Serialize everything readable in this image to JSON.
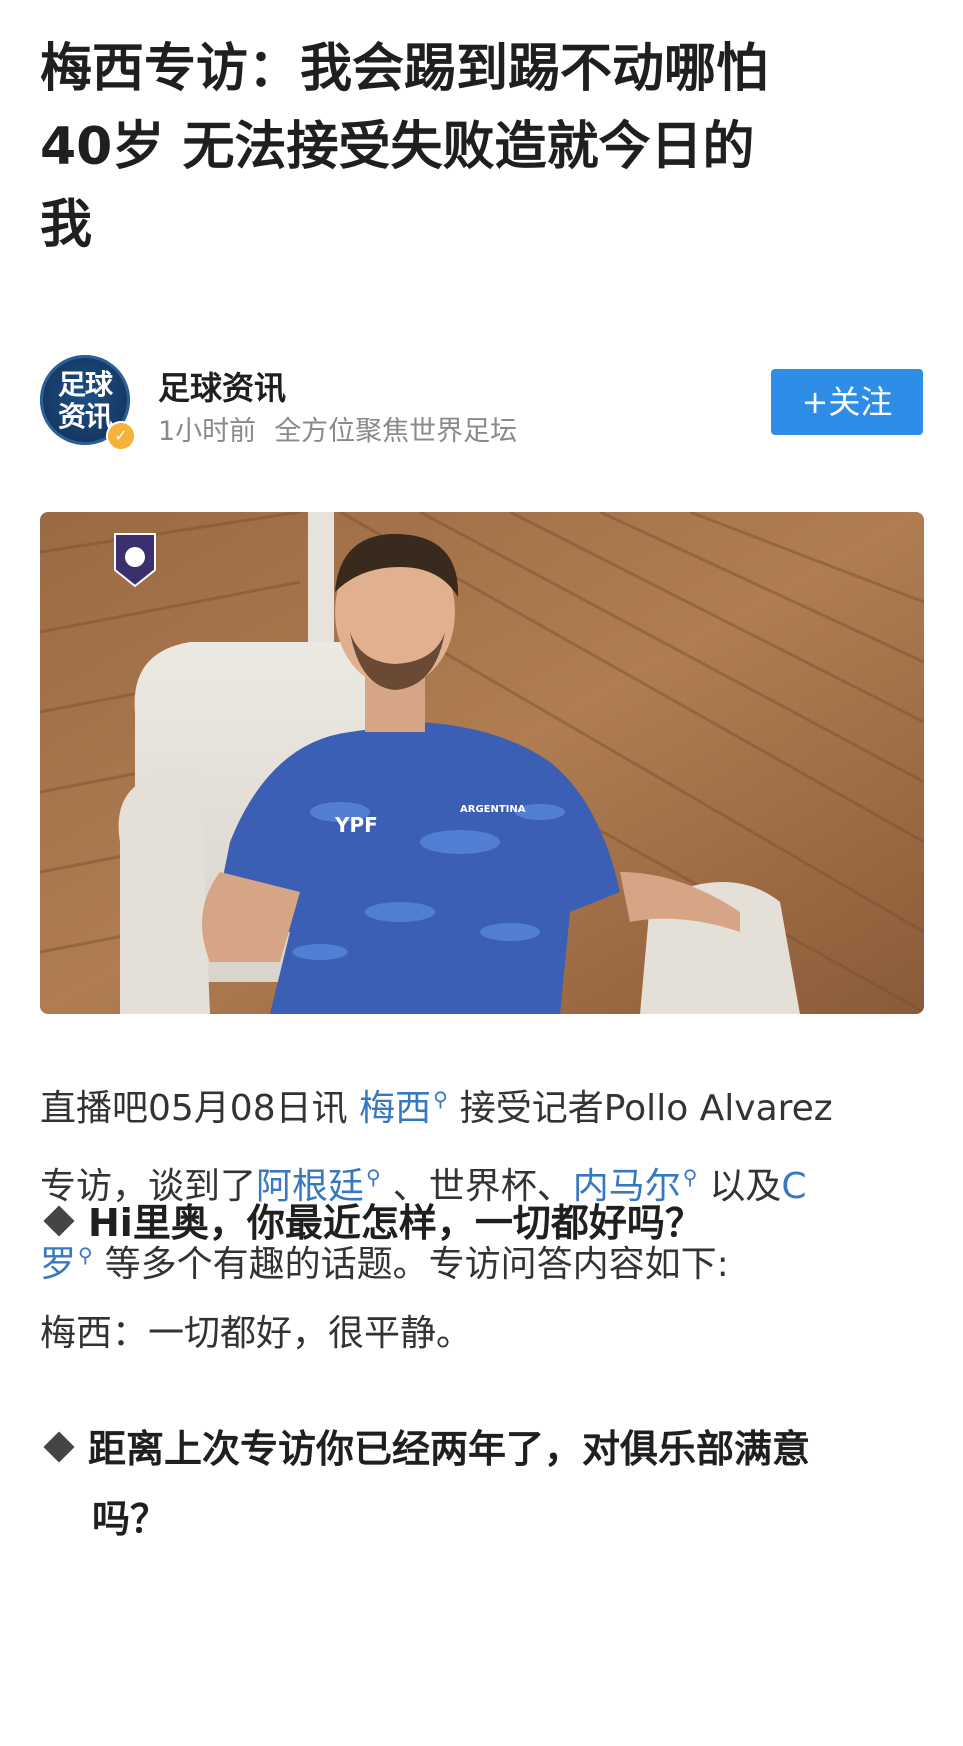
{
  "article": {
    "title_line1": "梅西专访：我会踢到踢不动哪怕",
    "title_line2": "40岁 无法接受失败造就今日的",
    "title_line3": "我"
  },
  "author": {
    "avatar_text_line1": "足球",
    "avatar_text_line2": "资讯",
    "name": "足球资讯",
    "time": "1小时前",
    "description": "全方位聚焦世界足坛",
    "follow_label": "+关注"
  },
  "hero_image": {
    "jersey_text": "YPF",
    "jersey_badge": "ARGENTINA"
  },
  "body": {
    "intro": {
      "prefix": "直播吧05月08日讯 ",
      "link1": "梅西",
      "part2": "接受记者Pollo Alvarez",
      "part3": "专访，谈到了",
      "link2": "阿根廷",
      "part4": "、世界杯、",
      "link3": "内马尔",
      "part5": "以及",
      "link4_a": "C",
      "link4_b": "罗",
      "part6": "等多个有趣的话题。专访问答内容如下:",
      "search_glyph": "⚲"
    },
    "q1": "Hi里奥，你最近怎样，一切都好吗？",
    "a1": "梅西：一切都好，很平静。",
    "q2_line1": "距离上次专访你已经两年了，对俱乐部满意",
    "q2_line2": "吗？"
  },
  "colors": {
    "link": "#3778c0",
    "follow_button": "#2e8de6",
    "title": "#1f1f1f"
  }
}
